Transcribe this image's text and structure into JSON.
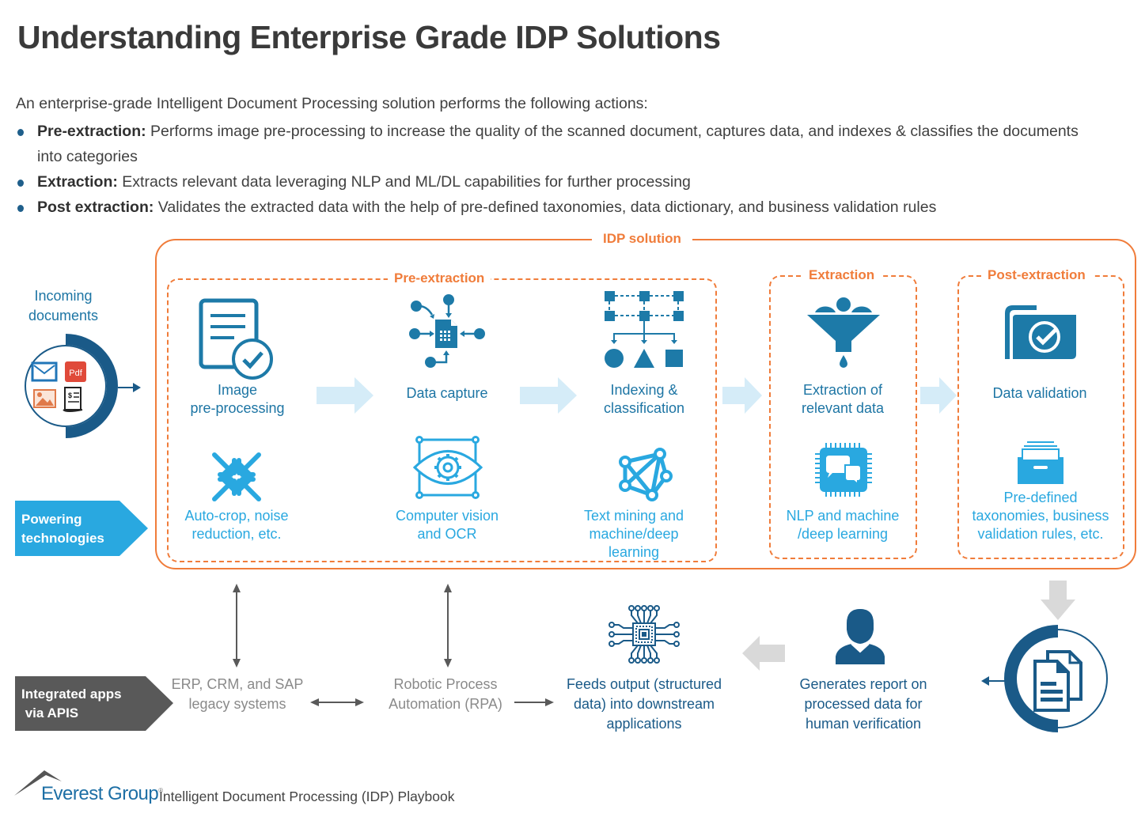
{
  "title": "Understanding Enterprise Grade IDP Solutions",
  "intro": "An enterprise-grade Intelligent Document Processing solution performs the following actions:",
  "bullets": [
    {
      "term": "Pre-extraction:",
      "text": " Performs image pre-processing to increase the quality of the scanned document, captures data, and indexes & classifies the documents into categories"
    },
    {
      "term": "Extraction:",
      "text": " Extracts relevant data leveraging NLP and ML/DL capabilities for further processing"
    },
    {
      "term": "Post extraction:",
      "text": " Validates the extracted data with the help of pre-defined taxonomies, data dictionary, and business validation rules"
    }
  ],
  "diagram": {
    "idp_label": "IDP solution",
    "incoming": {
      "label_line1": "Incoming",
      "label_line2": "documents",
      "icons": [
        "email-icon",
        "pdf-icon",
        "image-icon",
        "invoice-icon"
      ],
      "pdf_text": "Pdf"
    },
    "sections": {
      "pre_extraction": "Pre-extraction",
      "extraction": "Extraction",
      "post_extraction": "Post-extraction"
    },
    "steps": [
      {
        "line1": "Image",
        "line2": "pre-processing",
        "icon": "document-check-icon"
      },
      {
        "line1": "Data capture",
        "line2": "",
        "icon": "data-capture-icon"
      },
      {
        "line1": "Indexing &",
        "line2": "classification",
        "icon": "classification-icon"
      },
      {
        "line1": "Extraction of",
        "line2": "relevant data",
        "icon": "funnel-icon"
      },
      {
        "line1": "Data validation",
        "line2": "",
        "icon": "folder-check-icon"
      }
    ],
    "technologies": [
      {
        "line1": "Auto-crop, noise",
        "line2": "reduction, etc.",
        "line3": "",
        "icon": "compress-arrows-icon"
      },
      {
        "line1": "Computer vision",
        "line2": "and OCR",
        "line3": "",
        "icon": "eye-gear-icon"
      },
      {
        "line1": "Text mining and",
        "line2": "machine/deep",
        "line3": "learning",
        "icon": "network-icon"
      },
      {
        "line1": "NLP and machine",
        "line2": "/deep learning",
        "line3": "",
        "icon": "chip-chat-icon"
      },
      {
        "line1": "Pre-defined",
        "line2": "taxonomies, business",
        "line3": "validation rules, etc.",
        "icon": "file-drawer-icon"
      }
    ],
    "powering_tag": {
      "line1": "Powering",
      "line2": "technologies"
    },
    "integrated_tag": {
      "line1": "Integrated apps",
      "line2": " via APIS"
    },
    "bottom": {
      "erp": {
        "line1": "ERP, CRM, and SAP",
        "line2": "legacy systems"
      },
      "rpa": {
        "line1": "Robotic Process",
        "line2": "Automation (RPA)"
      },
      "feeds": {
        "line1": "Feeds output (structured",
        "line2": "data) into downstream",
        "line3": "applications"
      },
      "report": {
        "line1": "Generates report on",
        "line2": "processed data for",
        "line3": "human verification"
      }
    },
    "colors": {
      "orange": "#f07c3a",
      "navy": "#1a5a88",
      "teal": "#1d7aa8",
      "cyan": "#29a8e0",
      "light_arrow": "#d5ecf8",
      "gray_arrow": "#d9d9d9",
      "dark_tag": "#595959"
    }
  },
  "footer": {
    "brand": "Everest Group",
    "registered": "®",
    "text": "Intelligent Document Processing (IDP) Playbook"
  }
}
